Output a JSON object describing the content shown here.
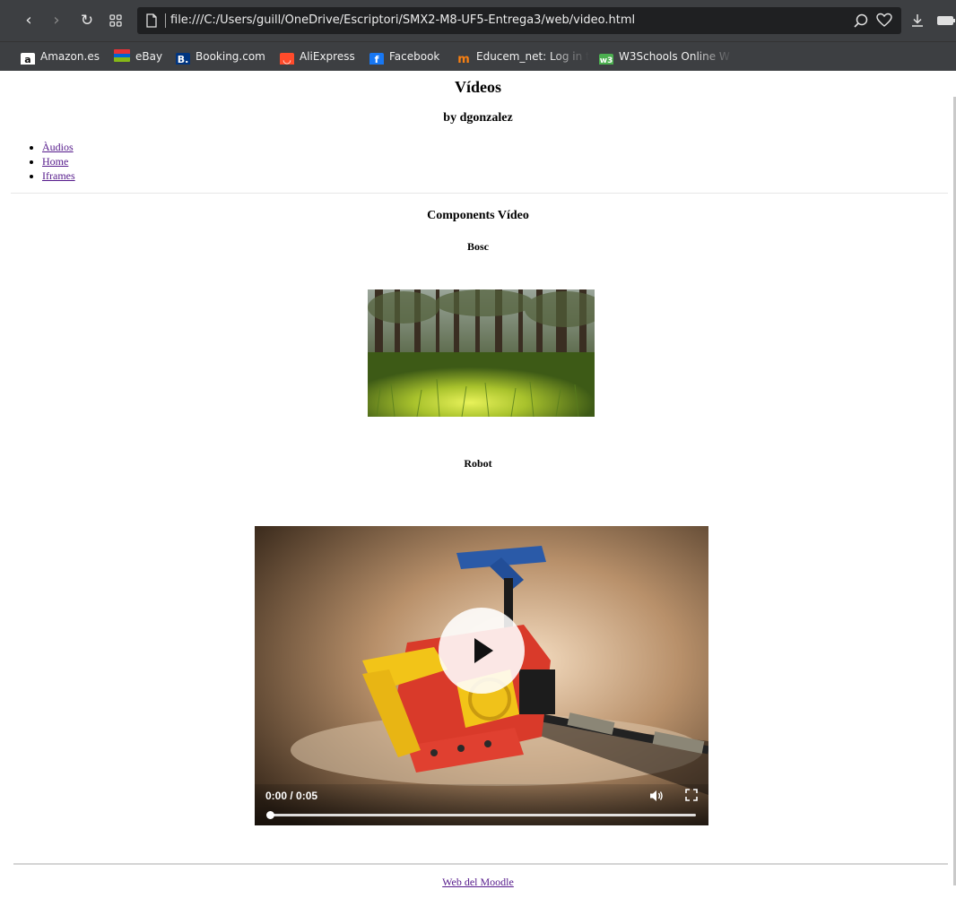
{
  "browser": {
    "url": "file:///C:/Users/guill/OneDrive/Escriptori/SMX2-M8-UF5-Entrega3/web/video.html",
    "bookmarks": [
      {
        "label": "Amazon.es",
        "icon": "amazon-icon",
        "color": "#ffffff"
      },
      {
        "label": "eBay",
        "icon": "ebay-icon",
        "color": "#e53238"
      },
      {
        "label": "Booking.com",
        "icon": "booking-icon",
        "color": "#003580"
      },
      {
        "label": "AliExpress",
        "icon": "aliexpress-icon",
        "color": "#ff4b2b"
      },
      {
        "label": "Facebook",
        "icon": "facebook-icon",
        "color": "#1877f2"
      },
      {
        "label": "Educem_net: Log in t",
        "icon": "moodle-icon",
        "color": "#f98012"
      },
      {
        "label": "W3Schools Online W",
        "icon": "w3schools-icon",
        "color": "#4caf50"
      }
    ]
  },
  "page": {
    "title": "Vídeos",
    "author": "by dgonzalez",
    "menu": [
      "Àudios",
      "Home",
      "Iframes"
    ],
    "section_title": "Components Vídeo",
    "video1_title": "Bosc",
    "video2_title": "Robot",
    "player": {
      "time": "0:00 / 0:05",
      "progress": 0
    },
    "footer_link": "Web del Moodle"
  }
}
